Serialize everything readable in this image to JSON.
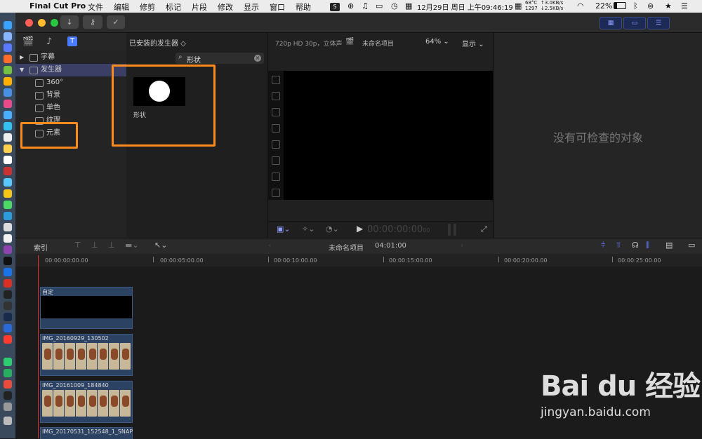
{
  "menubar": {
    "app_name": "Final Cut Pro",
    "menus": [
      "文件",
      "编辑",
      "修剪",
      "标记",
      "片段",
      "修改",
      "显示",
      "窗口",
      "帮助"
    ],
    "status": {
      "cpu_temp": "68°C",
      "fan": "1297",
      "net_up": "↑3.0KB/s",
      "net_down": "↓2.5KB/s",
      "datetime": "12月29日 周日 上午09:46:19",
      "battery": "22%"
    }
  },
  "libraries": {
    "header_filter": "已安装的发生器 ◇",
    "items": [
      {
        "label": "字幕",
        "expanded": false
      },
      {
        "label": "发生器",
        "expanded": true,
        "selected": true
      },
      {
        "label": "360°"
      },
      {
        "label": "背景"
      },
      {
        "label": "单色"
      },
      {
        "label": "纹理"
      },
      {
        "label": "元素"
      }
    ]
  },
  "browser": {
    "search_value": "形状",
    "thumb_label": "形状"
  },
  "viewer": {
    "format": "720p HD 30p，立体声",
    "project_name": "未命名项目",
    "zoom": "64%",
    "view_menu": "显示",
    "timecode": "00:00:00:00",
    "timecode_frames": "00"
  },
  "inspector": {
    "empty_text": "没有可检查的对象"
  },
  "timeline_toolbar": {
    "index_label": "索引",
    "project_name": "未命名项目",
    "duration": "04:01:00"
  },
  "ruler": {
    "ticks": [
      "00:00:00:00.00",
      "00:00:05:00.00",
      "00:00:10:00.00",
      "00:00:15:00.00",
      "00:00:20:00.00",
      "00:00:25:00.00"
    ]
  },
  "timeline": {
    "clips": [
      {
        "label": "自定"
      },
      {
        "label": "IMG_20160929_130502"
      },
      {
        "label": "IMG_20161009_184840"
      },
      {
        "label": "IMG_20170531_152548_1_SNAP"
      }
    ]
  },
  "watermark": {
    "logo": "Bai du 经验",
    "url": "jingyan.baidu.com"
  },
  "colors": {
    "highlight_box": "#ff8a1e",
    "selection": "#3b3f66",
    "accent": "#8fa0ff"
  }
}
